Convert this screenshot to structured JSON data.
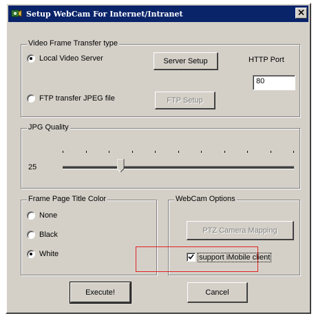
{
  "window": {
    "title": "Setup WebCam For Internet/Intranet",
    "close_symbol": "×"
  },
  "video_frame": {
    "legend": "Video Frame Transfer type",
    "local_server_label": "Local Video Server",
    "local_server_checked": true,
    "server_setup_label": "Server Setup",
    "http_port_label": "HTTP Port",
    "http_port_value": "80",
    "ftp_label": "FTP transfer JPEG file",
    "ftp_checked": false,
    "ftp_setup_label": "FTP Setup",
    "ftp_setup_enabled": false
  },
  "jpg_quality": {
    "legend": "JPG Quality",
    "value": "25",
    "slider_fraction": 0.25
  },
  "title_color": {
    "legend": "Frame Page Title Color",
    "options": [
      {
        "label": "None",
        "checked": false
      },
      {
        "label": "Black",
        "checked": false
      },
      {
        "label": "White",
        "checked": true
      }
    ]
  },
  "webcam_options": {
    "legend": "WebCam Options",
    "ptz_label": "PTZ Camera Mapping",
    "ptz_enabled": false,
    "imobile_label": "support iMobile client",
    "imobile_checked": true
  },
  "footer": {
    "execute_label": "Execute!",
    "cancel_label": "Cancel"
  },
  "colors": {
    "titlebar": "#0a246a",
    "dialog_face": "#d4d0c8",
    "highlight_box": "#e02020"
  },
  "icons": {
    "title_icon": "webcam-icon",
    "close_icon": "close-icon"
  }
}
